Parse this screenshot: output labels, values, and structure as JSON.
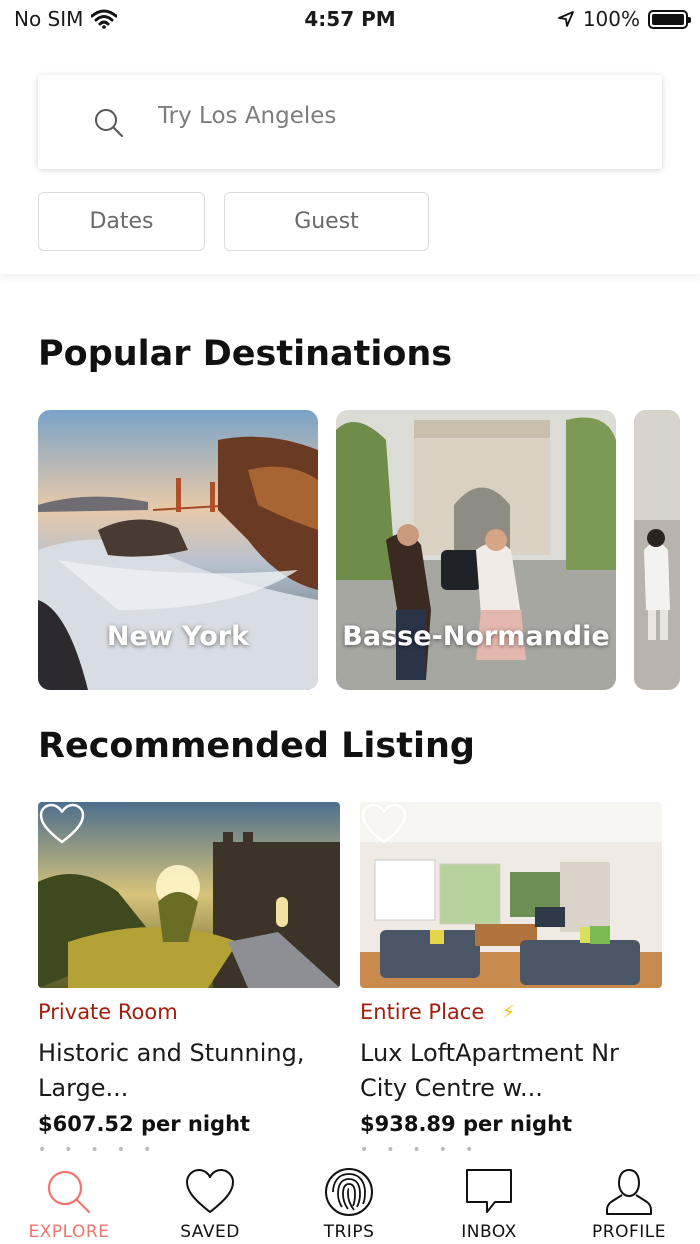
{
  "status_bar": {
    "carrier": "No SIM",
    "time": "4:57 PM",
    "battery": "100%"
  },
  "search": {
    "placeholder": "Try Los Angeles"
  },
  "filters": {
    "dates_label": "Dates",
    "guest_label": "Guest"
  },
  "popular": {
    "title": "Popular Destinations",
    "items": [
      {
        "name": "New York"
      },
      {
        "name": "Basse-Normandie"
      }
    ]
  },
  "recommended": {
    "title": "Recommended Listing",
    "items": [
      {
        "type": "Private Room",
        "title": "Historic and Stunning, Large...",
        "price": "$607.52 per night",
        "instant": false
      },
      {
        "type": "Entire Place",
        "title": "Lux LoftApartment Nr City Centre w...",
        "price": "$938.89 per night",
        "instant": true
      }
    ]
  },
  "tabs": [
    {
      "label": "EXPLORE",
      "icon": "search-icon",
      "active": true
    },
    {
      "label": "SAVED",
      "icon": "heart-icon",
      "active": false
    },
    {
      "label": "TRIPS",
      "icon": "fingerprint-icon",
      "active": false
    },
    {
      "label": "INBOX",
      "icon": "chat-bubble-icon",
      "active": false
    },
    {
      "label": "PROFILE",
      "icon": "user-icon",
      "active": false
    }
  ],
  "colors": {
    "accent": "#f0756d",
    "listing_type": "#a31e0b",
    "instant_bolt": "#f2c200"
  }
}
